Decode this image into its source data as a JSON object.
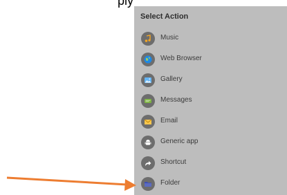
{
  "top_text": "ply",
  "dialog": {
    "title": "Select Action",
    "items": [
      {
        "label": "Music",
        "icon": "music-icon",
        "icon_color": "#f5a623"
      },
      {
        "label": "Web Browser",
        "icon": "globe-icon",
        "icon_color": "#1e88e5"
      },
      {
        "label": "Gallery",
        "icon": "gallery-icon",
        "icon_color": "#64b5f6"
      },
      {
        "label": "Messages",
        "icon": "message-icon",
        "icon_color": "#7cb342"
      },
      {
        "label": "Email",
        "icon": "email-icon",
        "icon_color": "#f9c74f"
      },
      {
        "label": "Generic app",
        "icon": "android-icon",
        "icon_color": "#ffffff"
      },
      {
        "label": "Shortcut",
        "icon": "shortcut-icon",
        "icon_color": "#ffffff"
      },
      {
        "label": "Folder",
        "icon": "folder-icon",
        "icon_color": "#3f51b5"
      }
    ]
  },
  "annotation": {
    "arrow_color": "#ed7d31"
  }
}
